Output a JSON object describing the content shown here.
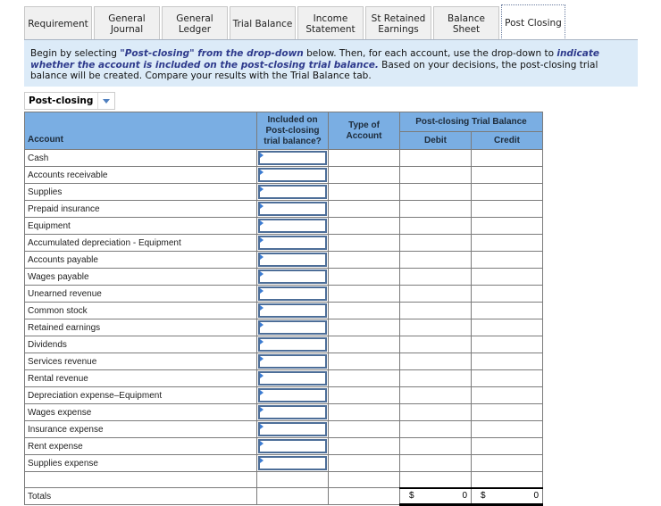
{
  "tabs": [
    {
      "label": "Requirement",
      "active": false
    },
    {
      "label": "General Journal",
      "active": false
    },
    {
      "label": "General Ledger",
      "active": false
    },
    {
      "label": "Trial Balance",
      "active": false
    },
    {
      "label": "Income Statement",
      "active": false
    },
    {
      "label": "St Retained Earnings",
      "active": false
    },
    {
      "label": "Balance Sheet",
      "active": false
    },
    {
      "label": "Post Closing",
      "active": true
    }
  ],
  "instructions": {
    "part1": "Begin by selecting ",
    "em1": "\"Post-closing\" from the drop-down",
    "part2": " below.  Then, for each account, use the drop-down to ",
    "em2": "indicate whether the account is included on the post-closing trial balance.",
    "part3": "  Based on your decisions, the post-closing trial balance will be created.  Compare your results with the Trial Balance tab."
  },
  "dropdown": {
    "selected": "Post-closing"
  },
  "table": {
    "headers": {
      "account": "Account",
      "included": "Included on Post-closing trial balance?",
      "type": "Type of Account",
      "group": "Post-closing Trial Balance",
      "debit": "Debit",
      "credit": "Credit"
    },
    "rows": [
      "Cash",
      "Accounts receivable",
      "Supplies",
      "Prepaid insurance",
      "Equipment",
      "Accumulated depreciation - Equipment",
      "Accounts payable",
      "Wages payable",
      "Unearned revenue",
      "Common stock",
      "Retained earnings",
      "Dividends",
      "Services revenue",
      "Rental revenue",
      "Depreciation expense–Equipment",
      "Wages expense",
      "Insurance expense",
      "Rent expense",
      "Supplies expense"
    ],
    "totals": {
      "label": "Totals",
      "debit_currency": "$",
      "debit_value": "0",
      "credit_currency": "$",
      "credit_value": "0"
    }
  }
}
